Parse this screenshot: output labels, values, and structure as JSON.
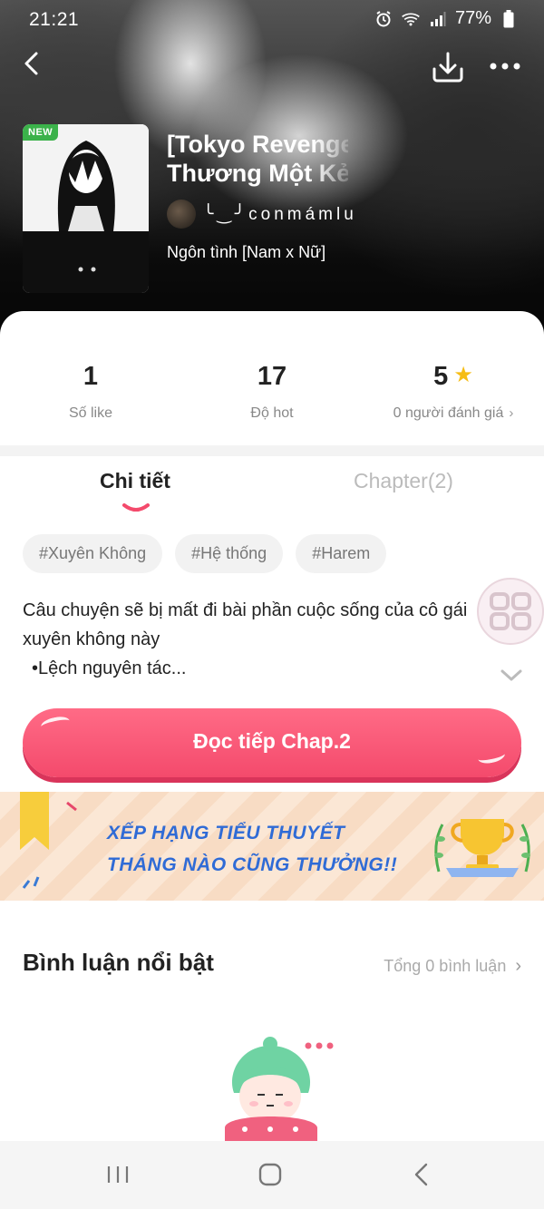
{
  "status_bar": {
    "time": "21:21",
    "battery": "77%",
    "icons": [
      "alarm-icon",
      "wifi-icon",
      "signal-icon",
      "battery-icon"
    ]
  },
  "header": {
    "title_line1": "[Tokyo Revenge",
    "title_line2": "Thương Một Kẻ",
    "author": "╰‿╯conmámlu",
    "genre": "Ngôn tình [Nam x Nữ]",
    "new_badge": "NEW"
  },
  "stats": [
    {
      "value": "1",
      "label": "Số like"
    },
    {
      "value": "17",
      "label": "Độ hot"
    },
    {
      "value": "5",
      "label": "0 người đánh giá"
    }
  ],
  "tabs": {
    "detail": "Chi tiết",
    "chapter": "Chapter(2)"
  },
  "tags": [
    "#Xuyên Không",
    "#Hệ thống",
    "#Harem"
  ],
  "description": {
    "line1": "Câu chuyện sẽ bị mất đi bài phần cuộc sống của cô gái",
    "line2": "xuyên không này",
    "line3": "•Lệch nguyên tác..."
  },
  "read_button": "Đọc tiếp Chap.2",
  "banner": {
    "line1": "XẾP HẠNG TIỂU THUYẾT",
    "line2": "THÁNG NÀO CŨNG THƯỞNG!!"
  },
  "comments": {
    "title": "Bình luận nổi bật",
    "total": "Tổng 0 bình luận"
  },
  "colors": {
    "accent": "#f44a6c",
    "banner_text": "#2f6bd6",
    "star": "#f6bd16",
    "new_badge": "#3bb24a"
  }
}
